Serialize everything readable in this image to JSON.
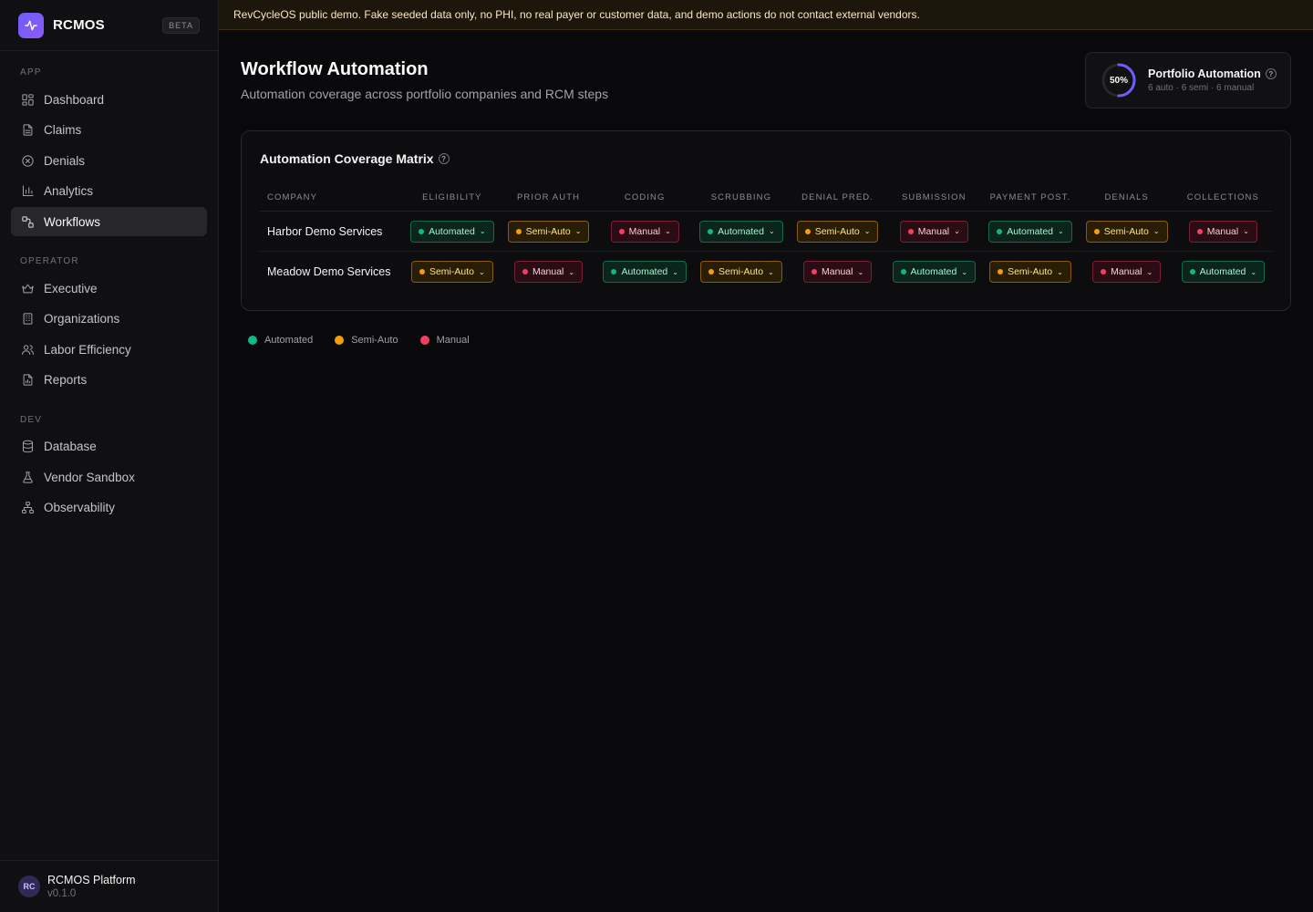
{
  "app": {
    "name": "RCMOS",
    "badge": "BETA"
  },
  "sidebar": {
    "sections": [
      {
        "label": "APP",
        "items": [
          {
            "label": "Dashboard",
            "icon": "dashboard-icon"
          },
          {
            "label": "Claims",
            "icon": "document-icon"
          },
          {
            "label": "Denials",
            "icon": "x-circle-icon"
          },
          {
            "label": "Analytics",
            "icon": "bar-chart-icon"
          },
          {
            "label": "Workflows",
            "icon": "workflow-icon",
            "active": true
          }
        ]
      },
      {
        "label": "OPERATOR",
        "items": [
          {
            "label": "Executive",
            "icon": "crown-icon"
          },
          {
            "label": "Organizations",
            "icon": "building-icon"
          },
          {
            "label": "Labor Efficiency",
            "icon": "users-icon"
          },
          {
            "label": "Reports",
            "icon": "report-icon"
          }
        ]
      },
      {
        "label": "DEV",
        "items": [
          {
            "label": "Database",
            "icon": "database-icon"
          },
          {
            "label": "Vendor Sandbox",
            "icon": "flask-icon"
          },
          {
            "label": "Observability",
            "icon": "network-icon"
          }
        ]
      }
    ],
    "footer": {
      "avatar": "RC",
      "title": "RCMOS Platform",
      "version": "v0.1.0"
    }
  },
  "banner": "RevCycleOS public demo. Fake seeded data only, no PHI, no real payer or customer data, and demo actions do not contact external vendors.",
  "page": {
    "title": "Workflow Automation",
    "subtitle": "Automation coverage across portfolio companies and RCM steps"
  },
  "kpi": {
    "percent_label": "50%",
    "percent": 50,
    "title": "Portfolio Automation",
    "summary": "6 auto · 6 semi · 6 manual"
  },
  "matrix": {
    "title": "Automation Coverage Matrix",
    "headers": [
      "COMPANY",
      "ELIGIBILITY",
      "PRIOR AUTH",
      "CODING",
      "SCRUBBING",
      "DENIAL PRED.",
      "SUBMISSION",
      "PAYMENT POST.",
      "DENIALS",
      "COLLECTIONS"
    ],
    "rows": [
      {
        "company": "Harbor Demo Services",
        "values": [
          "Automated",
          "Semi-Auto",
          "Manual",
          "Automated",
          "Semi-Auto",
          "Manual",
          "Automated",
          "Semi-Auto",
          "Manual"
        ]
      },
      {
        "company": "Meadow Demo Services",
        "values": [
          "Semi-Auto",
          "Manual",
          "Automated",
          "Semi-Auto",
          "Manual",
          "Automated",
          "Semi-Auto",
          "Manual",
          "Automated"
        ]
      }
    ]
  },
  "legend": [
    {
      "label": "Automated",
      "color": "#10b981"
    },
    {
      "label": "Semi-Auto",
      "color": "#f59e0b"
    },
    {
      "label": "Manual",
      "color": "#f43f5e"
    }
  ],
  "colors": {
    "accent": "#6d5dfc",
    "automated": "#10b981",
    "semi": "#f59e0b",
    "manual": "#f43f5e"
  }
}
